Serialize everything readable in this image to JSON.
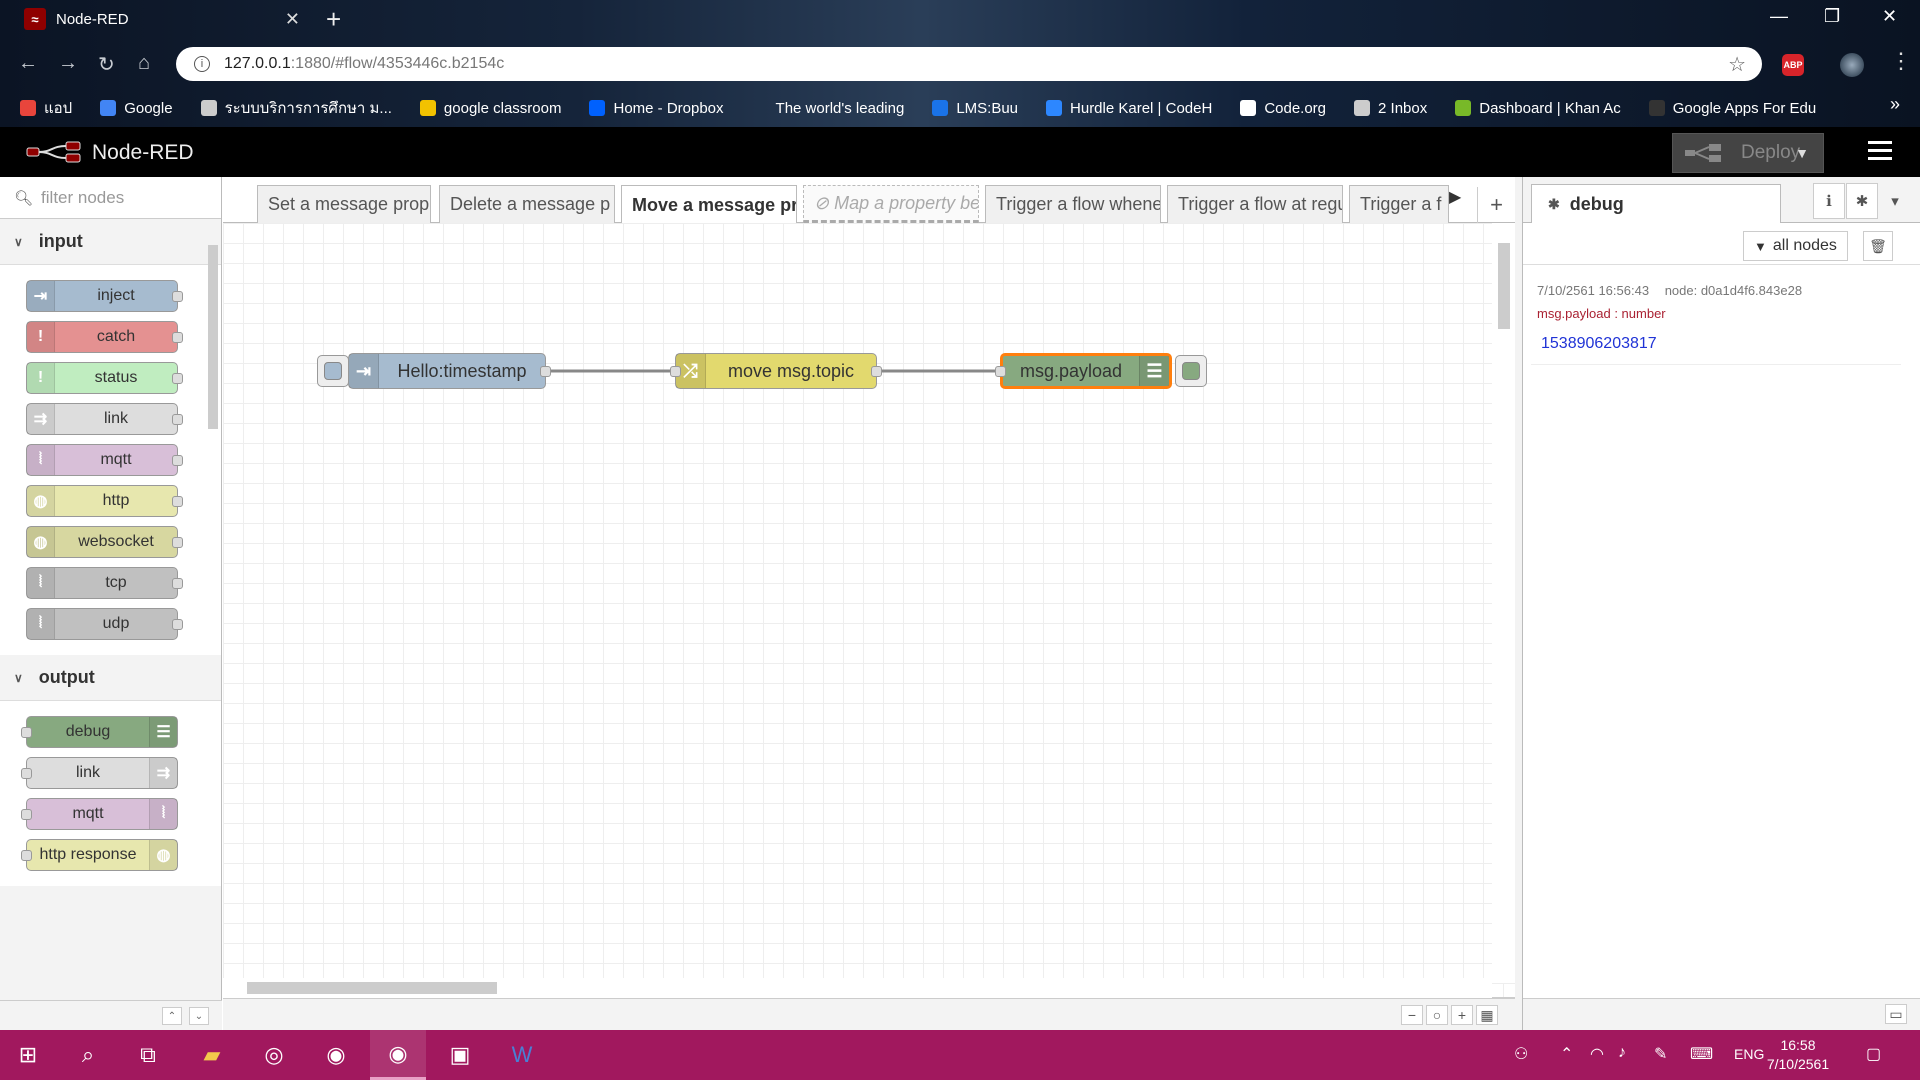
{
  "browser": {
    "tab_title": "Node-RED",
    "tab_close": "✕",
    "new_tab": "+",
    "url_host": "127.0.0.1",
    "url_rest": ":1880/#flow/4353446c.b2154c",
    "abp_label": "ABP",
    "bookmarks": [
      {
        "label": "แอป",
        "icon_color": "#e8453c"
      },
      {
        "label": "Google",
        "icon_color": "#4285f4"
      },
      {
        "label": "ระบบบริการการศึกษา ม...",
        "icon_color": "#cccccc"
      },
      {
        "label": "google classroom",
        "icon_color": "#f2c200"
      },
      {
        "label": "Home - Dropbox",
        "icon_color": "#0061fe"
      },
      {
        "label": "The world's leading",
        "icon_color": "transparent"
      },
      {
        "label": "LMS:Buu",
        "icon_color": "#1a73e8"
      },
      {
        "label": "Hurdle Karel | CodeH",
        "icon_color": "#2d87ff"
      },
      {
        "label": "Code.org",
        "icon_color": "#ffffff"
      },
      {
        "label": "2 Inbox",
        "icon_color": "#cccccc"
      },
      {
        "label": "Dashboard | Khan Ac",
        "icon_color": "#78b928"
      },
      {
        "label": "Google Apps For Edu",
        "icon_color": "#333333"
      }
    ],
    "bookmarks_more": "»"
  },
  "header": {
    "title": "Node-RED",
    "deploy_label": "Deploy"
  },
  "palette": {
    "search_placeholder": "filter nodes",
    "categories": [
      {
        "label": "input",
        "nodes": [
          {
            "label": "inject",
            "color": "#a6bbcf"
          },
          {
            "label": "catch",
            "color": "#e49191"
          },
          {
            "label": "status",
            "color": "#c0edc0"
          },
          {
            "label": "link",
            "color": "#dddddd"
          },
          {
            "label": "mqtt",
            "color": "#d8bfd8"
          },
          {
            "label": "http",
            "color": "#e7e7ae"
          },
          {
            "label": "websocket",
            "color": "#d7d7a0"
          },
          {
            "label": "tcp",
            "color": "#c0c0c0"
          },
          {
            "label": "udp",
            "color": "#c0c0c0"
          }
        ]
      },
      {
        "label": "output",
        "nodes": [
          {
            "label": "debug",
            "color": "#87a980"
          },
          {
            "label": "link",
            "color": "#dddddd"
          },
          {
            "label": "mqtt",
            "color": "#d8bfd8"
          },
          {
            "label": "http response",
            "color": "#e7e7ae"
          }
        ]
      }
    ]
  },
  "workspace": {
    "tabs": [
      {
        "label": "Set a message prop"
      },
      {
        "label": "Delete a message p"
      },
      {
        "label": "Move a message pr"
      },
      {
        "label": "Map a property be"
      },
      {
        "label": "Trigger a flow whene"
      },
      {
        "label": "Trigger a flow at regu"
      },
      {
        "label": "Trigger a f"
      }
    ],
    "nodes": {
      "inject": {
        "label": "Hello:timestamp",
        "color": "#a6bbcf"
      },
      "change": {
        "label": "move msg.topic",
        "color": "#e2d96e"
      },
      "debug": {
        "label": "msg.payload",
        "color": "#87a980"
      }
    }
  },
  "sidebar": {
    "tab_label": "debug",
    "filter_label": "all nodes",
    "message": {
      "timestamp": "7/10/2561 16:56:43",
      "node": "node: d0a1d4f6.843e28",
      "property": "msg.payload : number",
      "value": "1538906203817"
    }
  },
  "taskbar": {
    "lang": "ENG",
    "time": "16:58",
    "date": "7/10/2561",
    "accent": "#a1185e"
  }
}
